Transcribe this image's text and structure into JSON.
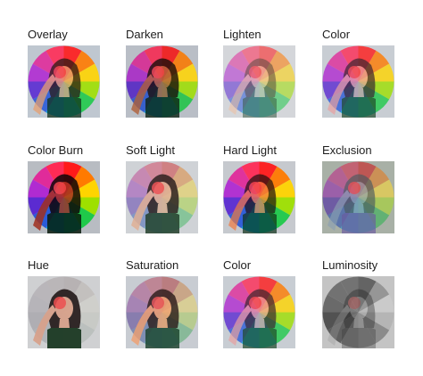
{
  "tiles": [
    {
      "label": "Overlay",
      "style": "overlay"
    },
    {
      "label": "Darken",
      "style": "darken"
    },
    {
      "label": "Lighten",
      "style": "lighten"
    },
    {
      "label": "Color",
      "style": "color"
    },
    {
      "label": "Color Burn",
      "style": "burn"
    },
    {
      "label": "Soft Light",
      "style": "soft"
    },
    {
      "label": "Hard Light",
      "style": "hard"
    },
    {
      "label": "Exclusion",
      "style": "exclusion"
    },
    {
      "label": "Hue",
      "style": "hue"
    },
    {
      "label": "Saturation",
      "style": "saturation"
    },
    {
      "label": "Color",
      "style": "color2"
    },
    {
      "label": "Luminosity",
      "style": "luminosity"
    }
  ],
  "colors": {
    "label": "#1e1e1e",
    "photo_bg": "#c9c9c9",
    "wheel": [
      "#ff1a1a",
      "#ff7a00",
      "#ffd400",
      "#9ee000",
      "#1fc94a",
      "#00c7b0",
      "#00a6e6",
      "#2a5bd8",
      "#5b2bd1",
      "#b02bd1",
      "#e02b9a",
      "#ff2b55"
    ]
  }
}
